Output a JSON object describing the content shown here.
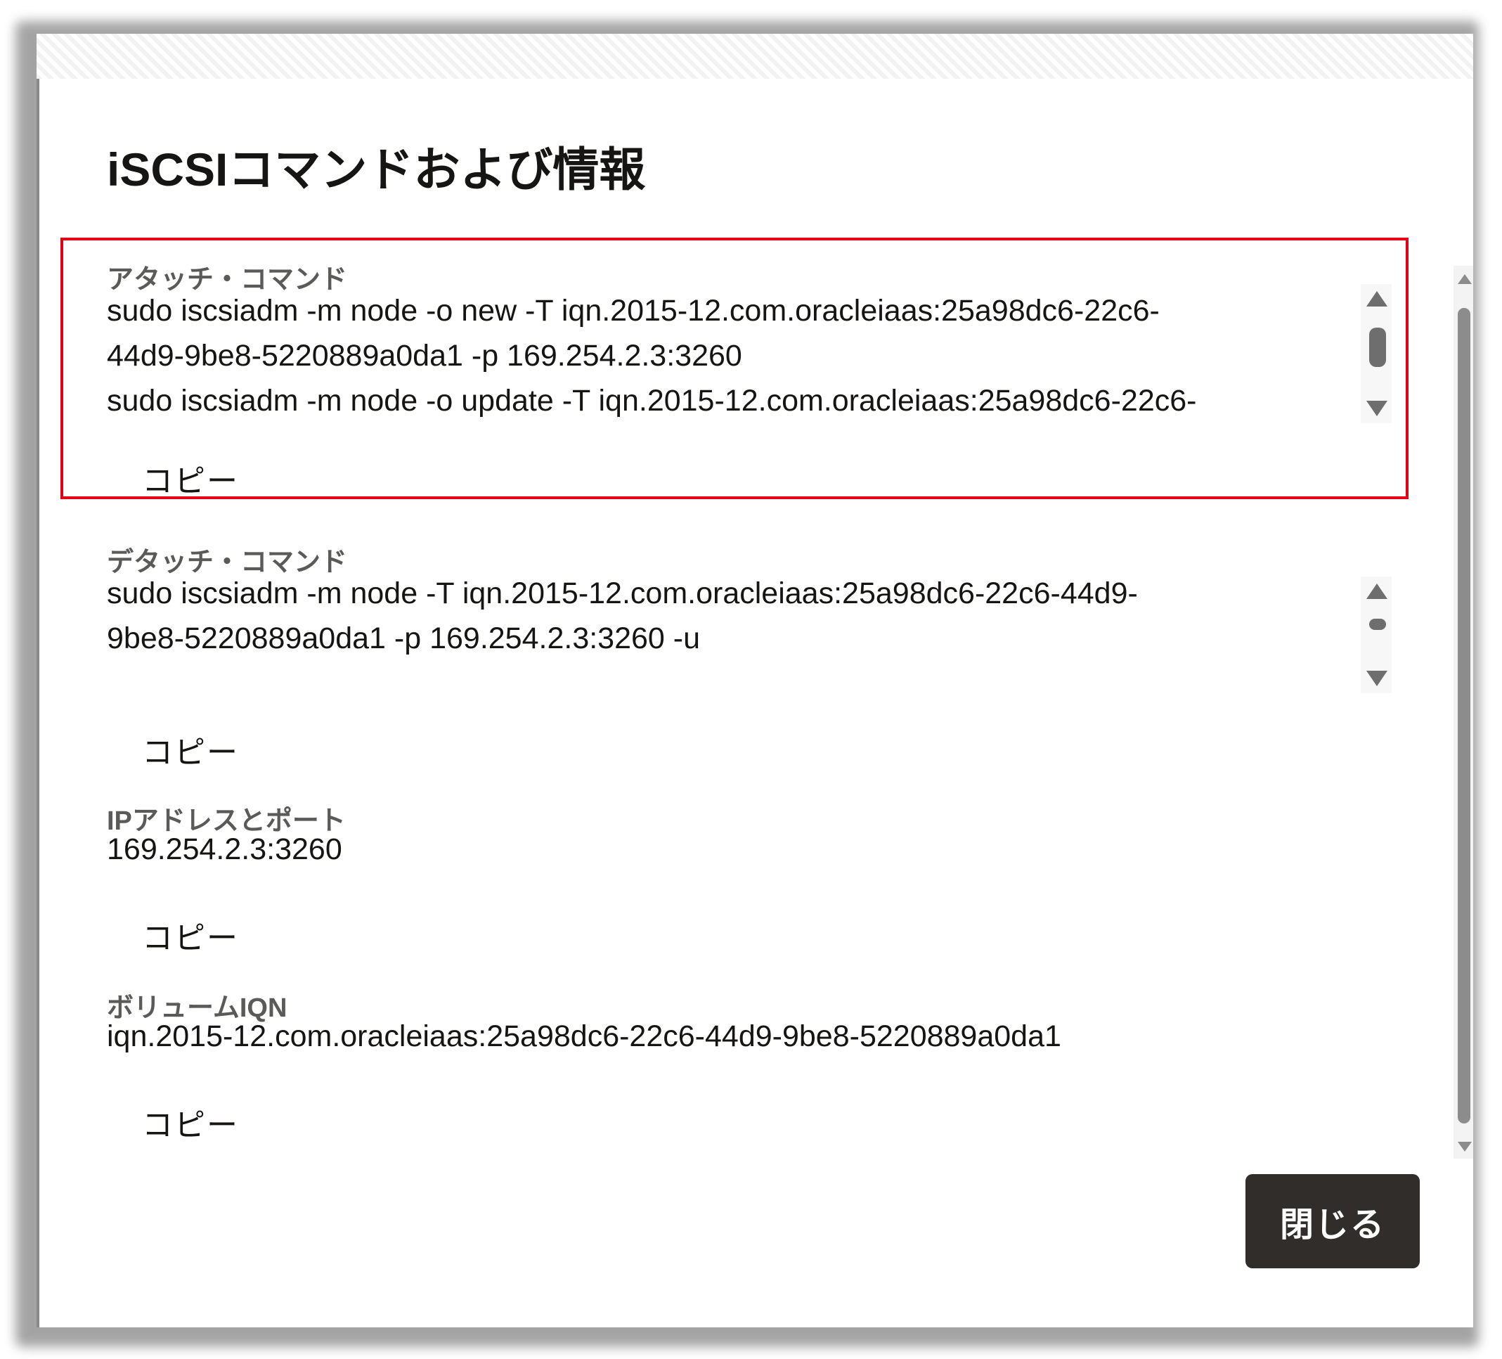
{
  "dialog": {
    "title": "iSCSIコマンドおよび情報",
    "close_label": "閉じる"
  },
  "sections": {
    "attach": {
      "label": "アタッチ・コマンド",
      "lines": [
        "sudo iscsiadm -m node -o new -T iqn.2015-12.com.oracleiaas:25a98dc6-22c6-",
        "44d9-9be8-5220889a0da1 -p 169.254.2.3:3260",
        "sudo iscsiadm -m node -o update -T iqn.2015-12.com.oracleiaas:25a98dc6-22c6-"
      ],
      "copy_label": "コピー"
    },
    "detach": {
      "label": "デタッチ・コマンド",
      "lines": [
        "sudo iscsiadm -m node -T iqn.2015-12.com.oracleiaas:25a98dc6-22c6-44d9-",
        "9be8-5220889a0da1 -p 169.254.2.3:3260 -u"
      ],
      "copy_label": "コピー"
    },
    "ip_port": {
      "label": "IPアドレスとポート",
      "value": "169.254.2.3:3260",
      "copy_label": "コピー"
    },
    "volume_iqn": {
      "label": "ボリュームIQN",
      "value": "iqn.2015-12.com.oracleiaas:25a98dc6-22c6-44d9-9be8-5220889a0da1",
      "copy_label": "コピー"
    }
  },
  "colors": {
    "highlight": "#e30016",
    "close_button_bg": "#312d2a",
    "label_text": "#5a5a58"
  }
}
